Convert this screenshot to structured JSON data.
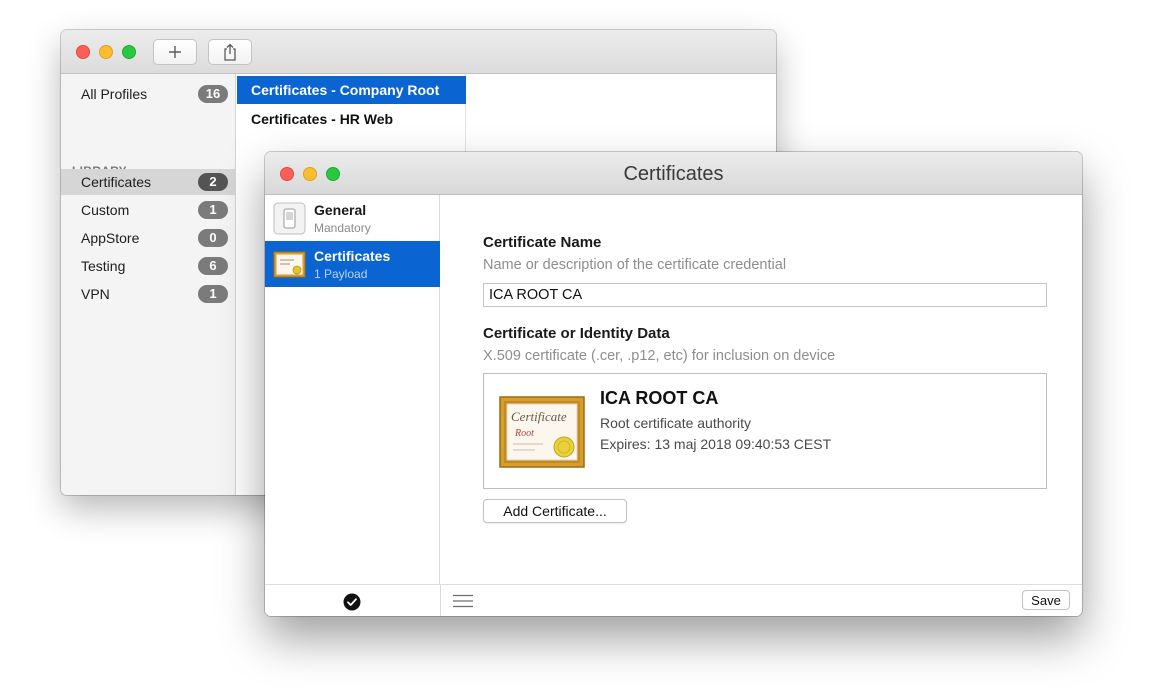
{
  "back_window": {
    "toolbar": {
      "add_icon": "plus-icon",
      "share_icon": "share-icon"
    },
    "sidebar": {
      "all_profiles": {
        "label": "All Profiles",
        "count": "16"
      },
      "section_title": "LIBRARY",
      "items": [
        {
          "label": "Certificates",
          "count": "2",
          "selected": true
        },
        {
          "label": "Custom",
          "count": "1"
        },
        {
          "label": "AppStore",
          "count": "0"
        },
        {
          "label": "Testing",
          "count": "6"
        },
        {
          "label": "VPN",
          "count": "1"
        }
      ]
    },
    "profile_list": [
      {
        "label": "Certificates - Company Root",
        "selected": true
      },
      {
        "label": "Certificates - HR Web"
      }
    ]
  },
  "front_window": {
    "title": "Certificates",
    "payloads": [
      {
        "title": "General",
        "subtitle": "Mandatory",
        "icon": "switch-icon"
      },
      {
        "title": "Certificates",
        "subtitle": "1 Payload",
        "icon": "certificate-icon",
        "selected": true
      }
    ],
    "form": {
      "name_label": "Certificate Name",
      "name_description": "Name or description of the certificate credential",
      "name_value": "ICA ROOT CA",
      "data_label": "Certificate or Identity Data",
      "data_description": "X.509 certificate (.cer, .p12, etc) for inclusion on device",
      "certificate": {
        "name": "ICA ROOT CA",
        "kind": "Root certificate authority",
        "expires": "Expires: 13 maj 2018 09:40:53 CEST",
        "image_text_1": "Certificate",
        "image_text_2": "Root"
      },
      "add_button": "Add Certificate..."
    },
    "footer": {
      "status_icon": "checkmark-icon",
      "menu_icon": "hamburger-menu-icon",
      "save_button": "Save"
    }
  },
  "colors": {
    "selection_blue": "#0a64d2",
    "badge_gray": "#7b7b7b",
    "traffic_red": "#fc5f57",
    "traffic_yellow": "#fdbc2e",
    "traffic_green": "#28c840"
  }
}
